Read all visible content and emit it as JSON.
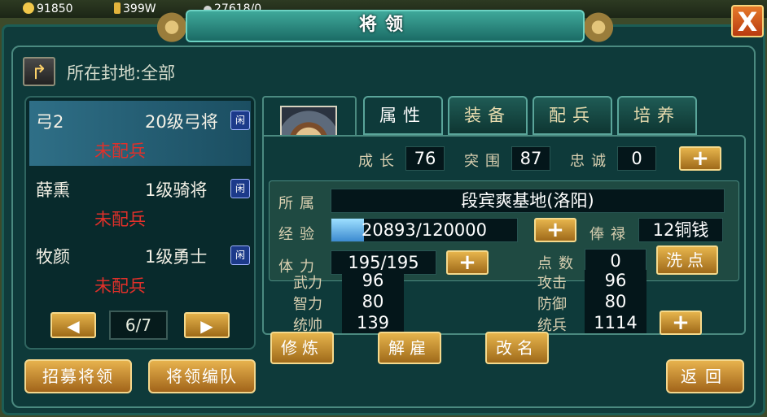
{
  "resources": {
    "gold": "91850",
    "food": "399W",
    "other": "27618/0"
  },
  "title": "将领",
  "close_label": "X",
  "fief_filter": "所在封地:全部",
  "generals": [
    {
      "name": "弓2",
      "level": "20级弓将",
      "idle": "闲",
      "status": "未配兵"
    },
    {
      "name": "薛熏",
      "level": "1级骑将",
      "idle": "闲",
      "status": "未配兵"
    },
    {
      "name": "牧颜",
      "level": "1级勇士",
      "idle": "闲",
      "status": "未配兵"
    }
  ],
  "pager": {
    "label": "6/7",
    "prev": "◀",
    "next": "▶"
  },
  "buttons": {
    "recruit": "招募将领",
    "formation": "将领编队",
    "return": "返回"
  },
  "tabs": [
    {
      "label": "属性"
    },
    {
      "label": "装备"
    },
    {
      "label": "配兵"
    },
    {
      "label": "培养"
    }
  ],
  "details": {
    "growth": {
      "label": "成长",
      "value": "76"
    },
    "breakout": {
      "label": "突围",
      "value": "87"
    },
    "loyalty": {
      "label": "忠诚",
      "value": "0"
    },
    "belongs": {
      "label": "所属",
      "value": "段宾爽基地(洛阳)"
    },
    "exp": {
      "label": "经验",
      "value": "20893/120000",
      "fraction": 0.174
    },
    "salary": {
      "label": "俸禄",
      "value": "12铜钱"
    },
    "stamina": {
      "label": "体力",
      "value": "195/195"
    },
    "points": {
      "label": "点数",
      "value": "0"
    },
    "wash": "洗点",
    "stats_left": [
      {
        "label": "武力",
        "value": "96"
      },
      {
        "label": "智力",
        "value": "80"
      },
      {
        "label": "统帅",
        "value": "139"
      }
    ],
    "stats_right": [
      {
        "label": "攻击",
        "value": "96"
      },
      {
        "label": "防御",
        "value": "80"
      },
      {
        "label": "统兵",
        "value": "1114"
      }
    ]
  },
  "actions": {
    "train": "修炼",
    "dismiss": "解雇",
    "rename": "改名"
  },
  "plus": "+"
}
